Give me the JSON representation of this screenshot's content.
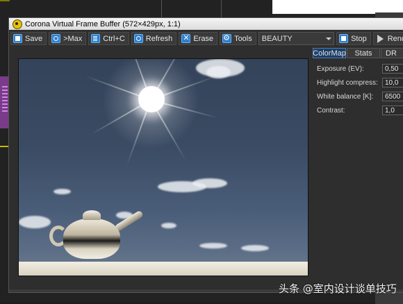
{
  "window": {
    "title": "Corona Virtual Frame Buffer (572×429px, 1:1)"
  },
  "toolbar": {
    "save_label": "Save",
    "max_label": ">Max",
    "copy_label": "Ctrl+C",
    "refresh_label": "Refresh",
    "erase_label": "Erase",
    "tools_label": "Tools",
    "pass_select_value": "BEAUTY",
    "stop_label": "Stop",
    "render_label": "Rend"
  },
  "tabs": [
    "ColorMap",
    "Stats",
    "DR"
  ],
  "colormap": {
    "rows": [
      {
        "label": "Exposure (EV):",
        "value": "0,50"
      },
      {
        "label": "Highlight compress:",
        "value": "10,0"
      },
      {
        "label": "White balance [K]:",
        "value": "6500"
      },
      {
        "label": "Contrast:",
        "value": "1,0"
      }
    ]
  },
  "watermark": "头条 @室内设计谈单技巧",
  "colors": {
    "accent": "#2c7fd0",
    "active_tab": "#1f3f66",
    "window_bg": "#2e2e2e"
  }
}
